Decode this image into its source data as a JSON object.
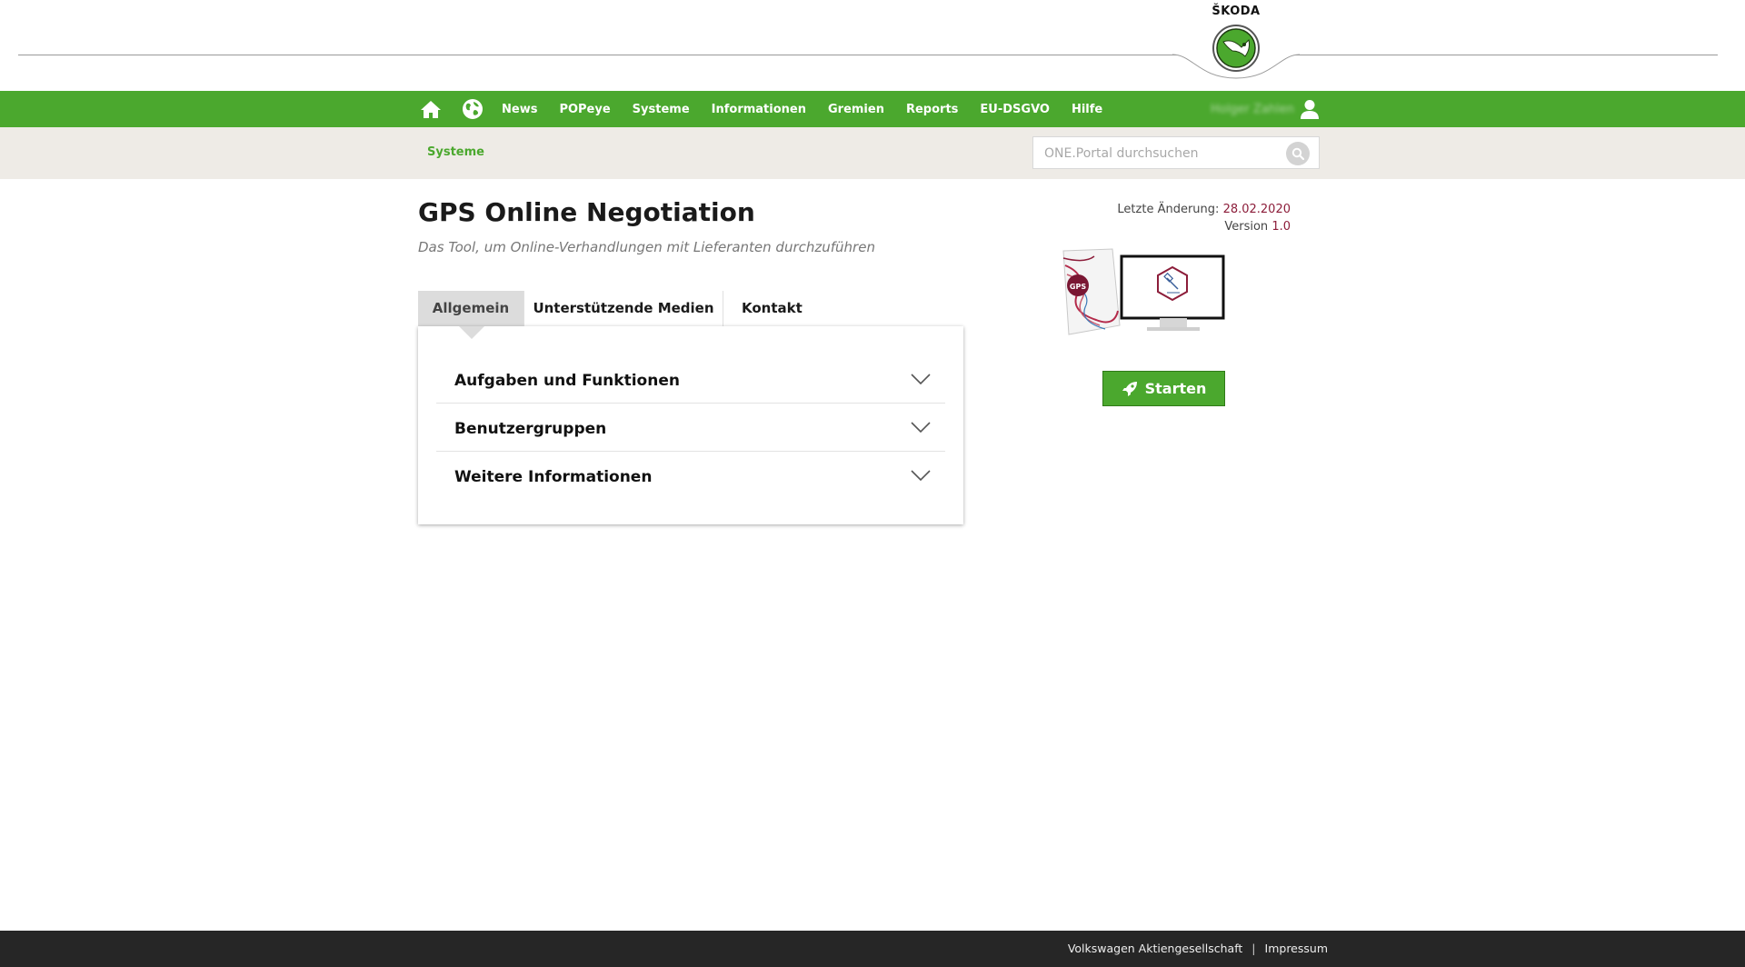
{
  "brand": {
    "wordmark": "ŠKODA",
    "accent": "#4ba82e",
    "nav_bg": "#4ba82e",
    "crumb_bg": "#eeebe6",
    "footer_bg": "#262626",
    "meta_value_color": "#8c1d3a"
  },
  "nav": {
    "icons": [
      "home-icon",
      "globe-icon"
    ],
    "items": [
      "News",
      "POPeye",
      "Systeme",
      "Informationen",
      "Gremien",
      "Reports",
      "EU-DSGVO",
      "Hilfe"
    ],
    "user": {
      "name": "Holger Zahlen",
      "icon": "user-icon"
    }
  },
  "breadcrumb": {
    "label": "Systeme"
  },
  "search": {
    "placeholder": "ONE.Portal durchsuchen",
    "icon": "search-icon"
  },
  "page": {
    "title": "GPS Online Negotiation",
    "subtitle": "Das Tool, um Online-Verhandlungen mit Lieferanten durchzuführen"
  },
  "meta": {
    "last_change_label": "Letzte Änderung:",
    "last_change_value": "28.02.2020",
    "version_label": "Version",
    "version_value": "1.0"
  },
  "tabs": [
    "Allgemein",
    "Unterstützende Medien",
    "Kontakt"
  ],
  "active_tab": "Allgemein",
  "accordion": [
    "Aufgaben und Funktionen",
    "Benutzergruppen",
    "Weitere Informationen"
  ],
  "start_button": {
    "label": "Starten",
    "icon": "rocket-icon"
  },
  "hero": {
    "badge": "GPS"
  },
  "footer": {
    "links": [
      "Volkswagen Aktiengesellschaft",
      "Impressum"
    ],
    "separator": "|"
  }
}
